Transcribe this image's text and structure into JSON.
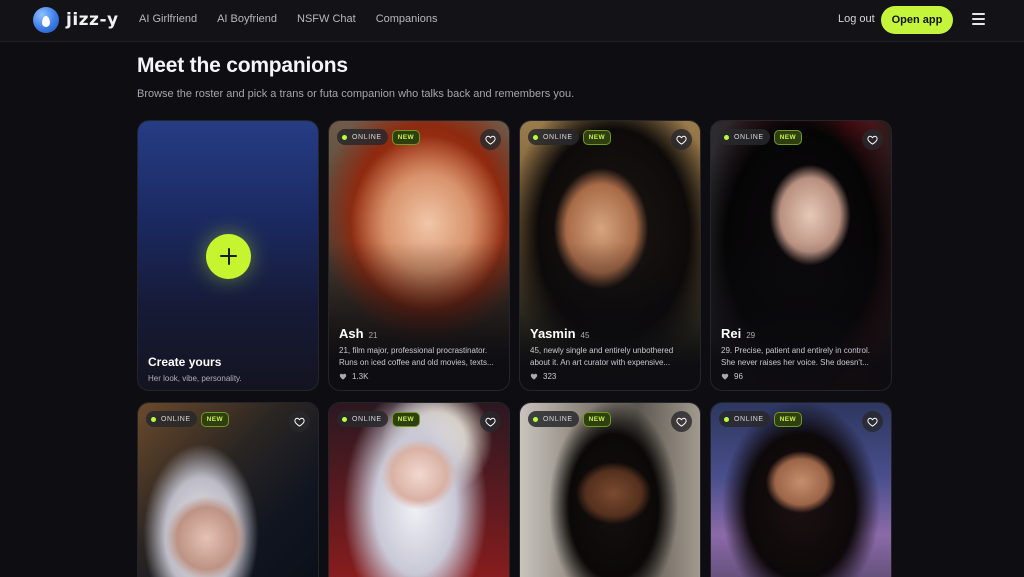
{
  "brand": {
    "name": "jizz-y",
    "accent": "#c6f42f"
  },
  "nav": {
    "links": [
      "AI Girlfriend",
      "AI Boyfriend",
      "NSFW Chat",
      "Companions"
    ],
    "logout": "Log out",
    "open_app": "Open app"
  },
  "page": {
    "title": "Meet the companions",
    "subtitle": "Browse the roster and pick a trans or futa companion who talks back and remembers you."
  },
  "create_card": {
    "title": "Create yours",
    "subtitle": "Her look, vibe, personality."
  },
  "badges": {
    "online": "ONLINE",
    "new": "NEW"
  },
  "companions": [
    {
      "name": "Ash",
      "age": "21",
      "desc_line1": "21, film major, professional procrastinator.",
      "desc_line2": "Runs on iced coffee and old movies, texts...",
      "likes": "1.3K"
    },
    {
      "name": "Yasmin",
      "age": "45",
      "desc_line1": "45, newly single and entirely unbothered",
      "desc_line2": "about it. An art curator with expensive...",
      "likes": "323"
    },
    {
      "name": "Rei",
      "age": "29",
      "desc_line1": "29. Precise, patient and entirely in control.",
      "desc_line2": "She never raises her voice. She doesn't...",
      "likes": "96"
    },
    {
      "name": "",
      "age": "",
      "desc_line1": "",
      "desc_line2": "",
      "likes": ""
    },
    {
      "name": "",
      "age": "",
      "desc_line1": "",
      "desc_line2": "",
      "likes": ""
    },
    {
      "name": "",
      "age": "",
      "desc_line1": "",
      "desc_line2": "",
      "likes": ""
    },
    {
      "name": "",
      "age": "",
      "desc_line1": "",
      "desc_line2": "",
      "likes": ""
    }
  ]
}
